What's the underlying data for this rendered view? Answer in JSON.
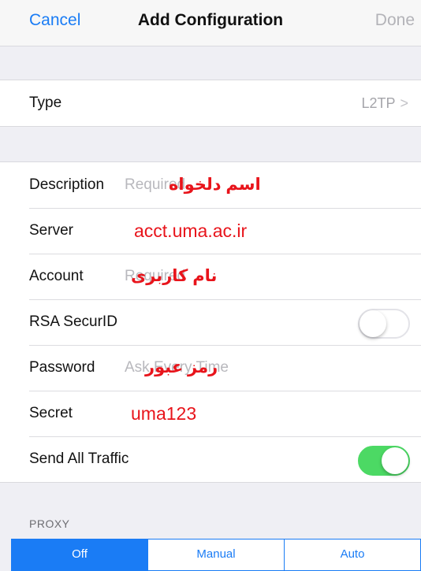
{
  "navbar": {
    "cancel_label": "Cancel",
    "title": "Add Configuration",
    "done_label": "Done"
  },
  "type_row": {
    "label": "Type",
    "value": "L2TP",
    "chevron": ">"
  },
  "fields": {
    "description": {
      "label": "Description",
      "placeholder": "Required",
      "note": "اسم دلخواه"
    },
    "server": {
      "label": "Server",
      "value": "acct.uma.ac.ir"
    },
    "account": {
      "label": "Account",
      "placeholder": "Required",
      "note": "نام کاربری"
    },
    "rsa_securid": {
      "label": "RSA SecurID",
      "toggle": "off"
    },
    "password": {
      "label": "Password",
      "placeholder": "Ask Every Time",
      "note": "رمز عبور"
    },
    "secret": {
      "label": "Secret",
      "value": "uma123"
    },
    "send_all_traffic": {
      "label": "Send All Traffic",
      "toggle": "on"
    }
  },
  "proxy": {
    "header": "PROXY",
    "options": [
      "Off",
      "Manual",
      "Auto"
    ],
    "selected": "Off"
  },
  "colors": {
    "ios_blue": "#1a7cf5",
    "toggle_green": "#4cd964",
    "annotation_red": "#e8141b",
    "background": "#efeff4"
  }
}
